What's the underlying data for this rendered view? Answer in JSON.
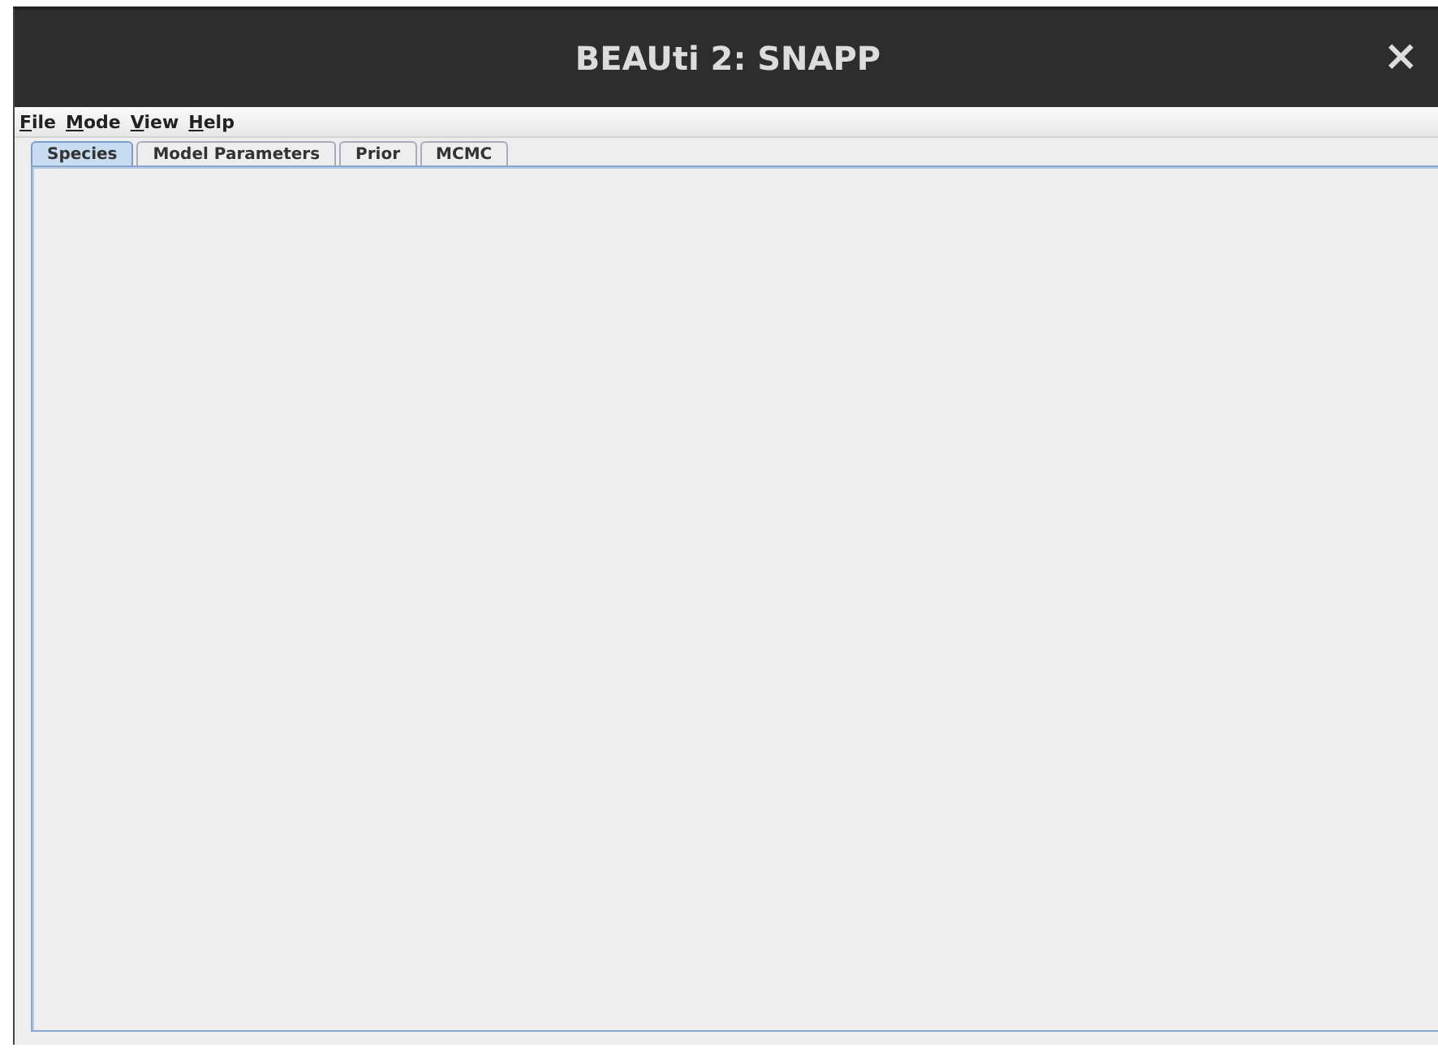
{
  "window": {
    "title": "BEAUti 2: SNAPP",
    "close": "×"
  },
  "menu": [
    "File",
    "Mode",
    "View",
    "Help"
  ],
  "tabs": [
    {
      "label": "Species",
      "selected": true
    },
    {
      "label": "Model Parameters",
      "selected": false
    },
    {
      "label": "Prior",
      "selected": false
    },
    {
      "label": "MCMC",
      "selected": false
    }
  ]
}
